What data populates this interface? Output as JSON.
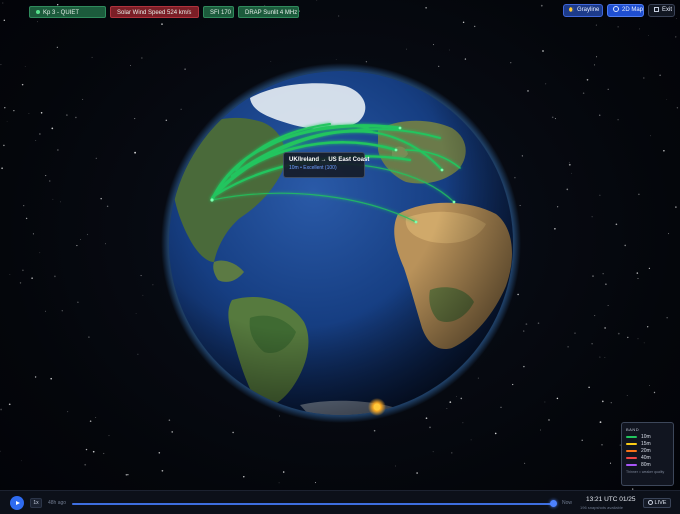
{
  "status_pills": {
    "kp": "Kp 3 - QUIET",
    "solar_wind": "Solar Wind Speed  524 km/s",
    "sfi": "SFI  170",
    "drap": "DRAP Sunlit  4 MHz"
  },
  "toolbar": {
    "grayline_label": "Grayline",
    "map2d_label": "2D Map",
    "exit_label": "Exit"
  },
  "tooltip": {
    "title": "UK/Ireland → US East Coast",
    "detail": "10m • Excellent (100)"
  },
  "legend": {
    "title": "BAND",
    "bands": [
      {
        "label": "10m",
        "color": "#22c55e"
      },
      {
        "label": "15m",
        "color": "#facc15"
      },
      {
        "label": "20m",
        "color": "#f97316"
      },
      {
        "label": "40m",
        "color": "#ef4444"
      },
      {
        "label": "80m",
        "color": "#a855f7"
      }
    ],
    "footer": "Thinner = weaker quality"
  },
  "timeline": {
    "speed": "1x",
    "start_label": "48h ago",
    "end_label": "Now",
    "position": 1.0,
    "time": "13:21 UTC 01/25",
    "snapshots": "196 snapshots available",
    "live_label": "LIVE"
  },
  "colors": {
    "accent": "#2f6bf0",
    "route": "#22c55e",
    "ocean": "#0f2a5e",
    "sun_marker": "#f5a623"
  }
}
